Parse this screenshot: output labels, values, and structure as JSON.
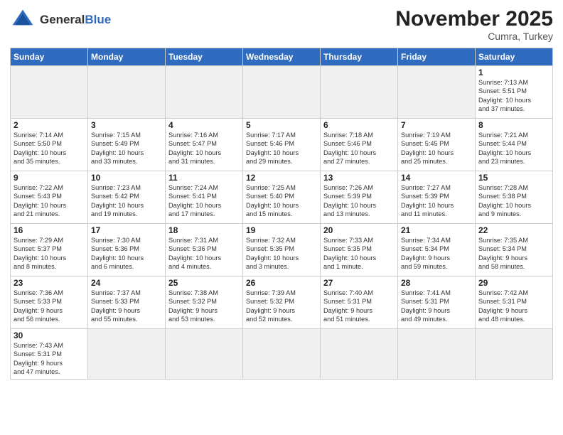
{
  "logo": {
    "line1": "General",
    "line2": "Blue"
  },
  "title": "November 2025",
  "location": "Cumra, Turkey",
  "weekdays": [
    "Sunday",
    "Monday",
    "Tuesday",
    "Wednesday",
    "Thursday",
    "Friday",
    "Saturday"
  ],
  "days": [
    {
      "num": "",
      "info": ""
    },
    {
      "num": "",
      "info": ""
    },
    {
      "num": "",
      "info": ""
    },
    {
      "num": "",
      "info": ""
    },
    {
      "num": "",
      "info": ""
    },
    {
      "num": "",
      "info": ""
    },
    {
      "num": "1",
      "info": "Sunrise: 7:13 AM\nSunset: 5:51 PM\nDaylight: 10 hours\nand 37 minutes."
    },
    {
      "num": "2",
      "info": "Sunrise: 7:14 AM\nSunset: 5:50 PM\nDaylight: 10 hours\nand 35 minutes."
    },
    {
      "num": "3",
      "info": "Sunrise: 7:15 AM\nSunset: 5:49 PM\nDaylight: 10 hours\nand 33 minutes."
    },
    {
      "num": "4",
      "info": "Sunrise: 7:16 AM\nSunset: 5:47 PM\nDaylight: 10 hours\nand 31 minutes."
    },
    {
      "num": "5",
      "info": "Sunrise: 7:17 AM\nSunset: 5:46 PM\nDaylight: 10 hours\nand 29 minutes."
    },
    {
      "num": "6",
      "info": "Sunrise: 7:18 AM\nSunset: 5:46 PM\nDaylight: 10 hours\nand 27 minutes."
    },
    {
      "num": "7",
      "info": "Sunrise: 7:19 AM\nSunset: 5:45 PM\nDaylight: 10 hours\nand 25 minutes."
    },
    {
      "num": "8",
      "info": "Sunrise: 7:21 AM\nSunset: 5:44 PM\nDaylight: 10 hours\nand 23 minutes."
    },
    {
      "num": "9",
      "info": "Sunrise: 7:22 AM\nSunset: 5:43 PM\nDaylight: 10 hours\nand 21 minutes."
    },
    {
      "num": "10",
      "info": "Sunrise: 7:23 AM\nSunset: 5:42 PM\nDaylight: 10 hours\nand 19 minutes."
    },
    {
      "num": "11",
      "info": "Sunrise: 7:24 AM\nSunset: 5:41 PM\nDaylight: 10 hours\nand 17 minutes."
    },
    {
      "num": "12",
      "info": "Sunrise: 7:25 AM\nSunset: 5:40 PM\nDaylight: 10 hours\nand 15 minutes."
    },
    {
      "num": "13",
      "info": "Sunrise: 7:26 AM\nSunset: 5:39 PM\nDaylight: 10 hours\nand 13 minutes."
    },
    {
      "num": "14",
      "info": "Sunrise: 7:27 AM\nSunset: 5:39 PM\nDaylight: 10 hours\nand 11 minutes."
    },
    {
      "num": "15",
      "info": "Sunrise: 7:28 AM\nSunset: 5:38 PM\nDaylight: 10 hours\nand 9 minutes."
    },
    {
      "num": "16",
      "info": "Sunrise: 7:29 AM\nSunset: 5:37 PM\nDaylight: 10 hours\nand 8 minutes."
    },
    {
      "num": "17",
      "info": "Sunrise: 7:30 AM\nSunset: 5:36 PM\nDaylight: 10 hours\nand 6 minutes."
    },
    {
      "num": "18",
      "info": "Sunrise: 7:31 AM\nSunset: 5:36 PM\nDaylight: 10 hours\nand 4 minutes."
    },
    {
      "num": "19",
      "info": "Sunrise: 7:32 AM\nSunset: 5:35 PM\nDaylight: 10 hours\nand 3 minutes."
    },
    {
      "num": "20",
      "info": "Sunrise: 7:33 AM\nSunset: 5:35 PM\nDaylight: 10 hours\nand 1 minute."
    },
    {
      "num": "21",
      "info": "Sunrise: 7:34 AM\nSunset: 5:34 PM\nDaylight: 9 hours\nand 59 minutes."
    },
    {
      "num": "22",
      "info": "Sunrise: 7:35 AM\nSunset: 5:34 PM\nDaylight: 9 hours\nand 58 minutes."
    },
    {
      "num": "23",
      "info": "Sunrise: 7:36 AM\nSunset: 5:33 PM\nDaylight: 9 hours\nand 56 minutes."
    },
    {
      "num": "24",
      "info": "Sunrise: 7:37 AM\nSunset: 5:33 PM\nDaylight: 9 hours\nand 55 minutes."
    },
    {
      "num": "25",
      "info": "Sunrise: 7:38 AM\nSunset: 5:32 PM\nDaylight: 9 hours\nand 53 minutes."
    },
    {
      "num": "26",
      "info": "Sunrise: 7:39 AM\nSunset: 5:32 PM\nDaylight: 9 hours\nand 52 minutes."
    },
    {
      "num": "27",
      "info": "Sunrise: 7:40 AM\nSunset: 5:31 PM\nDaylight: 9 hours\nand 51 minutes."
    },
    {
      "num": "28",
      "info": "Sunrise: 7:41 AM\nSunset: 5:31 PM\nDaylight: 9 hours\nand 49 minutes."
    },
    {
      "num": "29",
      "info": "Sunrise: 7:42 AM\nSunset: 5:31 PM\nDaylight: 9 hours\nand 48 minutes."
    },
    {
      "num": "30",
      "info": "Sunrise: 7:43 AM\nSunset: 5:31 PM\nDaylight: 9 hours\nand 47 minutes."
    },
    {
      "num": "",
      "info": ""
    },
    {
      "num": "",
      "info": ""
    },
    {
      "num": "",
      "info": ""
    },
    {
      "num": "",
      "info": ""
    },
    {
      "num": "",
      "info": ""
    },
    {
      "num": "",
      "info": ""
    }
  ]
}
